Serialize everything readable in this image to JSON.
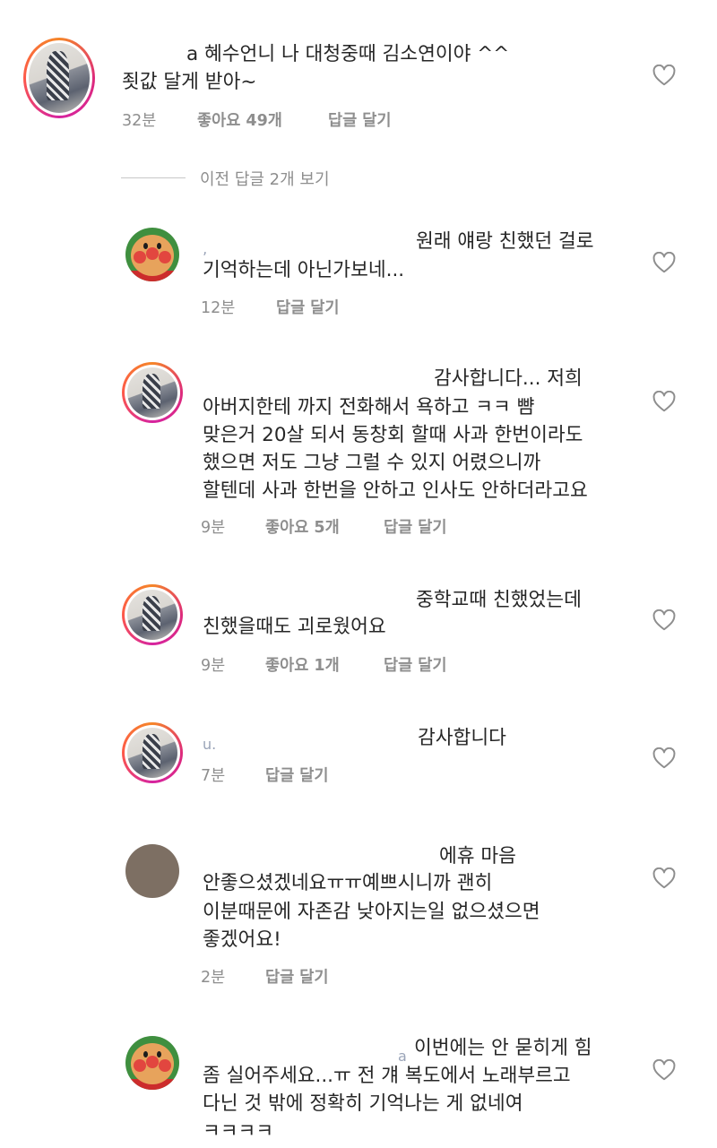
{
  "comments": [
    {
      "name_fragment": "a",
      "line1": "혜수언니 나 대청중때 김소연이야 ^^",
      "line2": "죗값 달게 받아~",
      "time": "32분",
      "likes": "좋아요 49개",
      "reply": "답글 달기"
    },
    {
      "line1": "원래 얘랑 친했던 걸로",
      "line2": "기억하는데 아닌가보네...",
      "time": "12분",
      "reply": "답글 달기"
    },
    {
      "line1": "감사합니다... 저희",
      "line2": "아버지한테 까지 전화해서 욕하고 ㅋㅋ 뺨",
      "line3": "맞은거 20살 되서 동창회 할때 사과 한번이라도",
      "line4": "했으면 저도 그냥 그럴 수 있지 어렸으니까",
      "line5": "할텐데 사과 한번을 안하고 인사도 안하더라고요",
      "time": "9분",
      "likes": "좋아요 5개",
      "reply": "답글 달기"
    },
    {
      "line1": "중학교때 친했었는데",
      "line2": "친했을때도 괴로웠어요",
      "time": "9분",
      "likes": "좋아요 1개",
      "reply": "답글 달기"
    },
    {
      "line1": "감사합니다",
      "time": "7분",
      "reply": "답글 달기"
    },
    {
      "line1": "에휴 마음",
      "line2": "안좋으셨겠네요ㅠㅠ예쁘시니까 괜히",
      "line3": "이분때문에 자존감 낮아지는일 없으셨으면",
      "line4": "좋겠어요!",
      "time": "2분",
      "reply": "답글 달기"
    },
    {
      "name_fragment": "a",
      "line1": "이번에는 안 묻히게 힘",
      "line2": "좀 실어주세요...ㅠ 전 걔 복도에서 노래부르고",
      "line3": "다닌 것 밖에 정확히 기억나는 게 없네여",
      "line4": "ㅋㅋㅋㅋ"
    }
  ],
  "view_previous_replies": "이전 답글 2개 보기",
  "icons": {
    "like": "heart-outline-icon"
  },
  "colors": {
    "text": "#262626",
    "meta": "#8e8e8e",
    "divider": "#c7c7c7"
  }
}
